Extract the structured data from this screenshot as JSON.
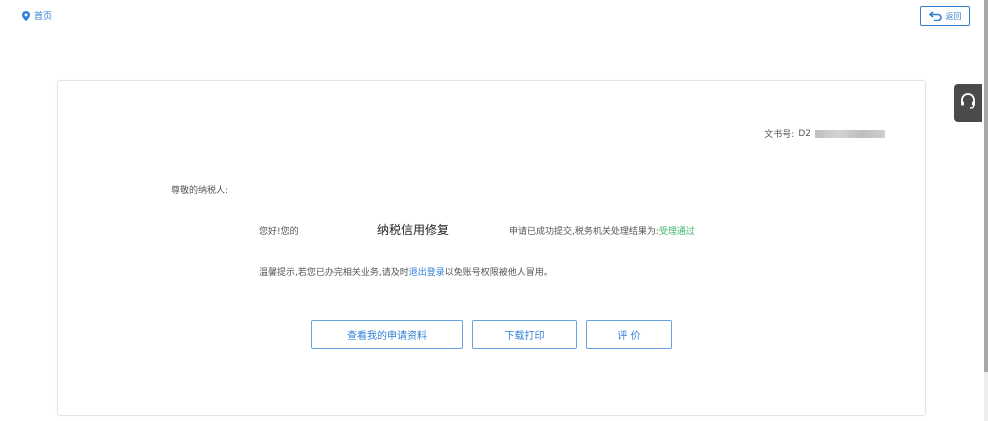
{
  "header": {
    "breadcrumb_home": "首页",
    "back_label": "返回"
  },
  "card": {
    "doc_number_label": "文书号:",
    "doc_number_prefix": "D2",
    "salutation": "尊敬的纳税人:",
    "greeting_prefix": "您好!您的",
    "service_name": "纳税信用修复",
    "greeting_suffix": "申请已成功提交,税务机关处理结果为:",
    "result": "受理通过",
    "reminder_prefix": "温馨提示,若您已办完相关业务,请及时",
    "logout_link": "退出登录",
    "reminder_suffix": "以免账号权限被他人冒用。",
    "buttons": {
      "view": "查看我的申请资料",
      "download": "下载打印",
      "rate": "评 价"
    }
  },
  "colors": {
    "accent": "#2f7fd6",
    "success": "#3bb56b",
    "widget": "#4a4a4a"
  },
  "icons": {
    "breadcrumb": "location-pin-icon",
    "back": "return-arrow-icon",
    "support": "headset-icon"
  }
}
